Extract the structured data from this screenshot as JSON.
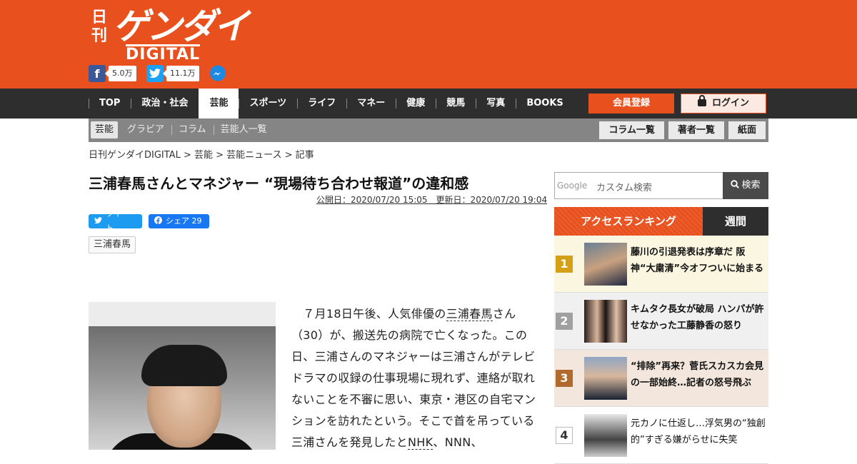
{
  "header": {
    "logo_kanji": "日刊",
    "logo_brand": "ゲンダイ",
    "logo_sub": "DIGITAL",
    "facebook_icon": "facebook-icon",
    "facebook_count": "5.0万",
    "twitter_icon": "twitter-icon",
    "twitter_count": "11.1万",
    "messenger_icon": "messenger-icon"
  },
  "nav": {
    "items": [
      "TOP",
      "政治・社会",
      "芸能",
      "スポーツ",
      "ライフ",
      "マネー",
      "健康",
      "競馬",
      "写真",
      "BOOKS"
    ],
    "active": "芸能",
    "register": "会員登録",
    "login": "ログイン"
  },
  "subnav": {
    "items": [
      "芸能",
      "グラビア",
      "コラム",
      "芸能人一覧"
    ],
    "buttons": [
      "コラム一覧",
      "著者一覧",
      "紙面"
    ]
  },
  "breadcrumb": "日刊ゲンダイDIGITAL > 芸能 > 芸能ニュース > 記事",
  "article": {
    "title": "三浦春馬さんとマネジャー “現場待ち合わせ報道”の違和感",
    "dates": "公開日：2020/07/20 15:05　更新日：2020/07/20 19:04",
    "tweet": "ツイート",
    "share": "シェア 29",
    "tag": "三浦春馬",
    "body_pre": "　７月18日午後、人気俳優の",
    "body_link": "三浦春馬",
    "body_mid": "さん（30）が、搬送先の病院で亡くなった。この日、三浦さんのマネジャーは三浦さんがテレビドラマの収録の仕事現場に現れず、連絡が取れないことを不審に思い、東京・港区の自宅マンションを訪れたという。そこで首を吊っている三浦さんを発見したと",
    "body_link2": "NHK",
    "body_post": "、NNN、"
  },
  "search": {
    "google": "Google",
    "placeholder": "カスタム検索",
    "button": "検索"
  },
  "ranking": {
    "title": "アクセスランキング",
    "tab": "週間",
    "items": [
      {
        "num": "1",
        "text": "藤川の引退発表は序章だ 阪神“大粛清”今オフついに始まる",
        "bg": "#faf6e0",
        "color": "#d4a017"
      },
      {
        "num": "2",
        "text": "キムタク長女が破局 ハンパが許せなかった工藤静香の怒り",
        "bg": "#f0f0f0",
        "color": "#a0a0a0"
      },
      {
        "num": "3",
        "text": "“排除”再来？菅氏スカスカ会見の一部始終…記者の怒号飛ぶ",
        "bg": "#f3e6dc",
        "color": "#b06a2e"
      },
      {
        "num": "4",
        "text": "元カノに仕返し…浮気男の“独創的”すぎる嫌がらせに失笑",
        "bg": "#ffffff",
        "color": "#ffffff"
      }
    ]
  }
}
